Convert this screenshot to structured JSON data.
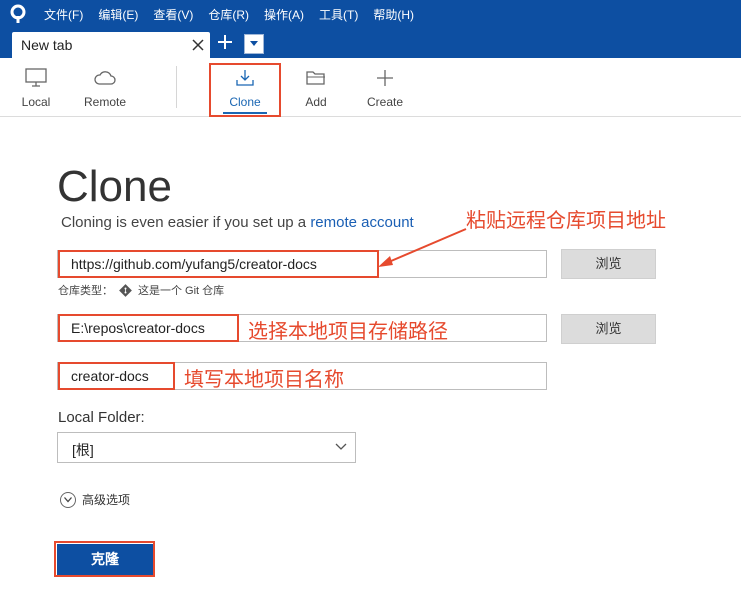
{
  "menu": [
    "文件(F)",
    "编辑(E)",
    "查看(V)",
    "仓库(R)",
    "操作(A)",
    "工具(T)",
    "帮助(H)"
  ],
  "tab": {
    "label": "New tab"
  },
  "toolbar": {
    "local": "Local",
    "remote": "Remote",
    "clone": "Clone",
    "add": "Add",
    "create": "Create"
  },
  "page": {
    "title": "Clone",
    "subtitle_prefix": "Cloning is even easier if you set up a ",
    "subtitle_link": "remote account"
  },
  "form": {
    "source_url": "https://github.com/yufang5/creator-docs",
    "browse_label": "浏览",
    "repo_type_prefix": "仓库类型：",
    "repo_type_value": "这是一个 Git 仓库",
    "dest_path": "E:\\repos\\creator-docs",
    "name": "creator-docs",
    "local_folder_label": "Local Folder:",
    "local_folder_value": "[根]",
    "advanced_label": "高级选项",
    "clone_button": "克隆"
  },
  "annotations": {
    "url_note": "粘贴远程仓库项目地址",
    "path_note": "选择本地项目存储路径",
    "name_note": "填写本地项目名称"
  },
  "colors": {
    "brand": "#0d4fa2",
    "annotation": "#e64a2e",
    "link": "#1a5fb4"
  }
}
